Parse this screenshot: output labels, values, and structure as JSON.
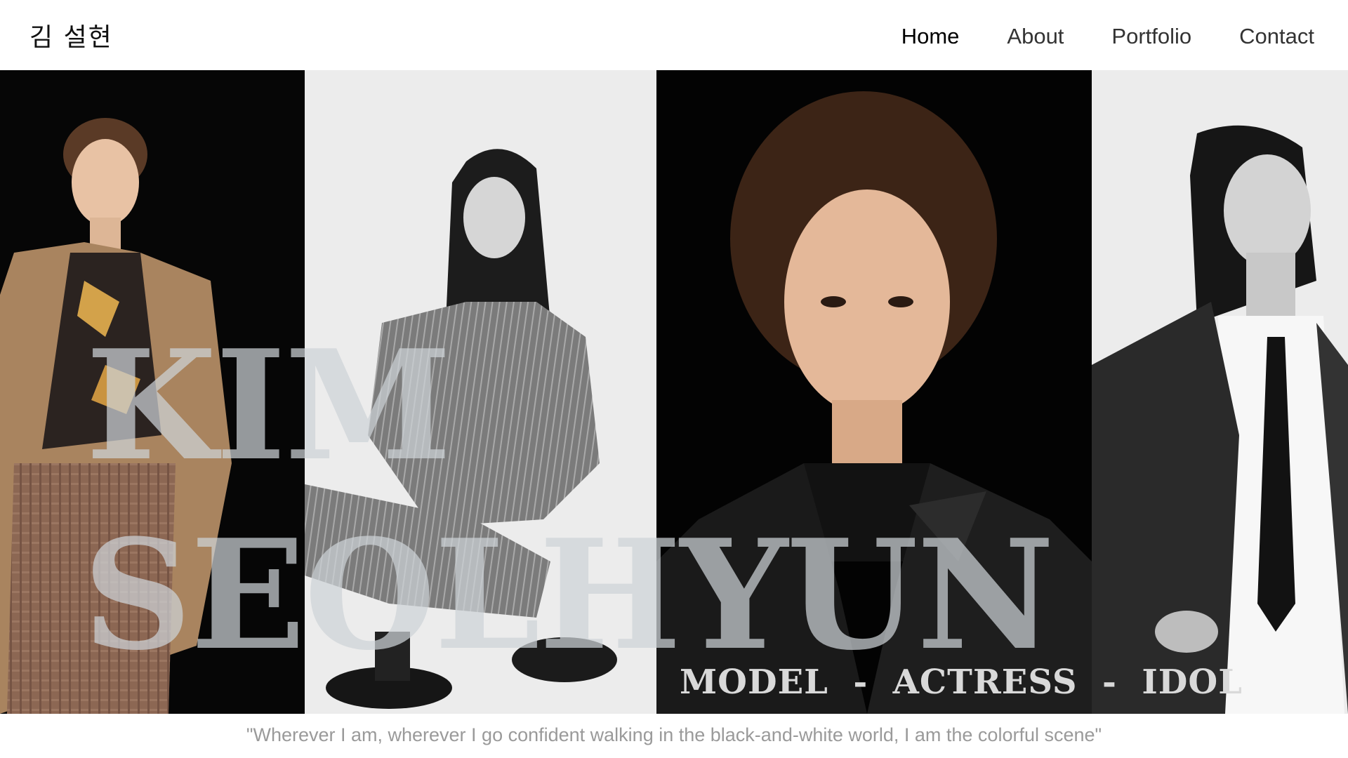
{
  "header": {
    "logo": "김 설현",
    "nav": [
      {
        "label": "Home",
        "active": true
      },
      {
        "label": "About",
        "active": false
      },
      {
        "label": "Portfolio",
        "active": false
      },
      {
        "label": "Contact",
        "active": false
      }
    ]
  },
  "hero": {
    "title_line1": "KIM",
    "title_line2": "SEOLHYUN",
    "roles": "MODEL  -  ACTRESS  -  IDOL",
    "accent_color": "#628cac"
  },
  "quote": "\"Wherever I am, wherever I go confident walking in the black-and-white world, I am the colorful scene\""
}
